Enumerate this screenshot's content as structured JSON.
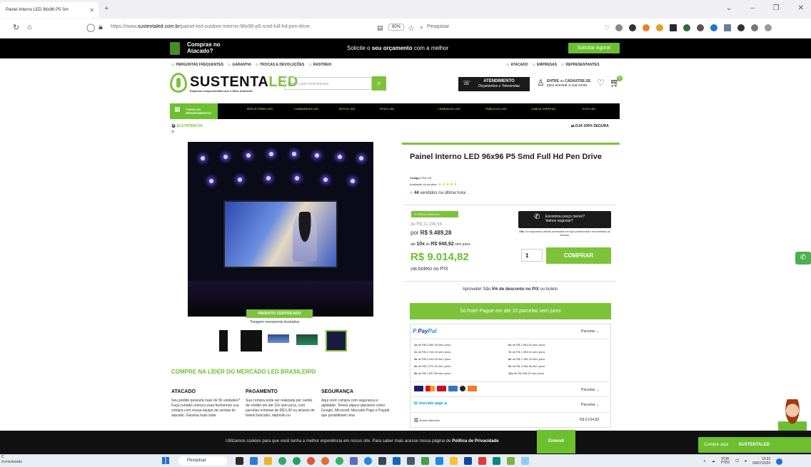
{
  "browser": {
    "tab_title": "Painel Interno LED 96x96 P5 Sm",
    "url_prefix": "https://www.",
    "url_domain": "sustentaled.com.br",
    "url_path": "/painel-led-outdoor-interno-96x96-p5-smd-full-hd-pen-drive",
    "zoom": "80%",
    "search_placeholder": "Pesquisar"
  },
  "promo": {
    "title": "Compras no Atacado?",
    "message_pre": "Solicite o ",
    "message_bold": "seu orçamento",
    "message_post": " com a melhor",
    "button": "Solicitar Agora!"
  },
  "top_links_left": [
    "PERGUNTAS FREQUENTES",
    "GARANTIA",
    "TROCAS E DEVOLUÇÕES",
    "RASTREIO"
  ],
  "top_links_right": [
    "ATACADO",
    "EMPRESAS",
    "REPRESENTANTES"
  ],
  "logo": {
    "part1": "SUSTENTA",
    "part2": "LED",
    "tagline": "Empresa comprometida com o Meio Ambiente"
  },
  "site_search": {
    "placeholder": "Digite o que você procura"
  },
  "atendimento": {
    "title": "ATENDIMENTO",
    "sub": "Orçamentos e Televendas"
  },
  "account": {
    "line1_a": "ENTRE",
    "line1_b": " ou ",
    "line1_c": "CADASTRE-SE",
    "line2": "para acessar a sua conta"
  },
  "cart_count": "0",
  "categories": {
    "all": "TODOS OS DEPARTAMENTOS",
    "items": [
      "REFLETORES LED",
      "LUMINÁRIAS LED",
      "SPOTS LED",
      "FITAS LED",
      "LÂMPADAS LED",
      "PÚBLICAS LED",
      "CABOS OFERTAS",
      "KITS LED"
    ]
  },
  "breadcrumb": {
    "item": "ELETRÔNICOS",
    "arrow": ">"
  },
  "secure": "LOJA 100% SEGURA",
  "image": {
    "badge": "PRODUTO CERTIFICADO",
    "caption": "*Imagem meramente ilustrativa"
  },
  "info": {
    "headline": "COMPRE NA LÍDER DO MERCADO LED BRASILEIRO",
    "columns": [
      {
        "title": "ATACADO",
        "text": "Seu pedido possuirá mais de 50 unidades? Faça contato conosco para fecharmos sua compra com nossa equipe de vendas do atacado. Garanta mais mais"
      },
      {
        "title": "PAGAMENTO",
        "text": "Sua compra pode ser realizada por cartão de crédito em até 10x sem juros, com parcelas mínimas de R$ 5,00 ou através de boleto bancário, depósito ou"
      },
      {
        "title": "SEGURANÇA",
        "text": "Aqui você compra com segurança e agilidade. Temos alguns parceiros como Google, Microsoft, Mercado Pago e Paypal que possibilitam uma"
      }
    ]
  },
  "product": {
    "name": "Painel Interno LED 96x96 P5 Smd Full Hd Pen Drive",
    "code_label": "Código:",
    "code": "PNL-P5",
    "rating_label": "Avaliação do produto:",
    "rating": 5,
    "sold_count": "44",
    "sold_text": " vendidos na última hora",
    "price_drop": "O PREÇO BAIXOU!",
    "from_price": "de R$ 11.246,56",
    "por_label": "por ",
    "price": "R$ 9.489,28",
    "ate": "até ",
    "installments": "10x",
    "de": " de ",
    "installment_value": "R$ 948,92",
    "sem_juros": " sem juros",
    "cash_price": "R$ 9.014,82",
    "cash_via": "via boleto ou PIX",
    "whatsapp_l1": "Encontrou preço menor?",
    "whatsapp_l2": "Vamos negociar?",
    "obs_label": "Obs:",
    "obs": " Só negociamos ofertas anunciadas em lojas profissionais e reconhecidas do mercado.",
    "qty": "1",
    "buy": "COMPRAR",
    "pix_pre": "Aproveite! São ",
    "pix_bold": "5% de desconto no PIX",
    "pix_post": " ou boleto",
    "parcel_banner": "Só hoje! Pague em até 10 parcelas sem juros"
  },
  "payment": {
    "paypal_a": "Pay",
    "paypal_b": "Pal",
    "parcelas_label": "Parcelas ⌄",
    "left": [
      {
        "n": "1x",
        "text": " de R$ 9.489,28 sem juros"
      },
      {
        "n": "2x",
        "text": " de R$ 4.744,64 sem juros"
      },
      {
        "n": "3x",
        "text": " de R$ 3.163,09 sem juros"
      },
      {
        "n": "4x",
        "text": " de R$ 2.372,32 sem juros"
      },
      {
        "n": "5x",
        "text": " de R$ 1.897,85 sem juros"
      }
    ],
    "right": [
      {
        "n": "6x",
        "text": " de R$ 1.581,54 sem juros"
      },
      {
        "n": "7x",
        "text": " de R$ 1.355,61 sem juros"
      },
      {
        "n": "8x",
        "text": " de R$ 1.186,16 sem juros"
      },
      {
        "n": "9x",
        "text": " de R$ 1.054,36 sem juros"
      },
      {
        "n": "10x",
        "text": " de R$ 948,92 sem juros"
      }
    ],
    "mp_label": "mercado pago",
    "boleto_label": "Boleto Bancário",
    "boleto_value": "R$ 9.014,82"
  },
  "cookie": {
    "text": "Utilizamos cookies para que você tenha a melhor experiência em nosso site. Para saber mais acesse nossa página de ",
    "link": "Política de Privacidade",
    "button": "Entendi"
  },
  "chat": {
    "label": "Compre aqui",
    "brand": "SUSTENTALED"
  },
  "taskbar": {
    "left_l1": "C",
    "left_l2": "d ensolarado",
    "search": "Pesquisar",
    "lang1": "POR",
    "lang2": "PTB2",
    "time": "13:33",
    "date": "08/07/2024"
  },
  "colors": {
    "brand_green": "#7cc33a",
    "dark": "#111111"
  }
}
